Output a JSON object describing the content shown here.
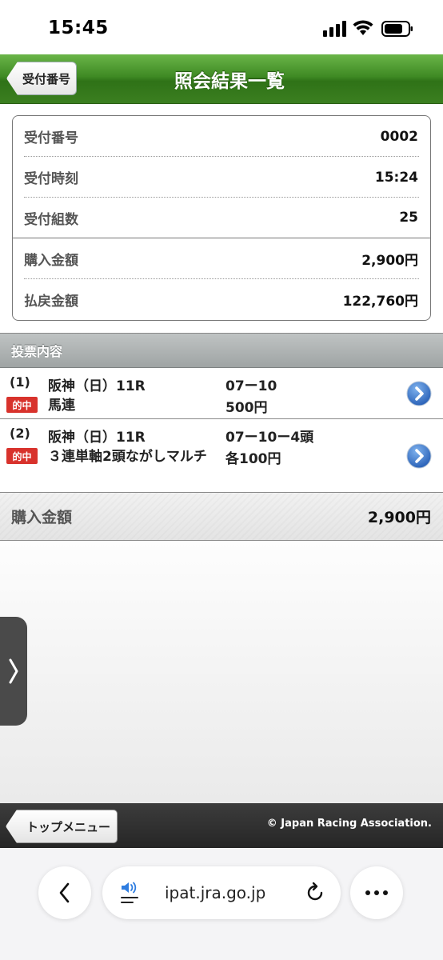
{
  "status_bar": {
    "time": "15:45"
  },
  "header": {
    "back_label": "受付番号",
    "title": "照会結果一覧"
  },
  "summary": {
    "rows": [
      {
        "label": "受付番号",
        "value": "0002"
      },
      {
        "label": "受付時刻",
        "value": "15:24"
      },
      {
        "label": "受付組数",
        "value": "25"
      },
      {
        "label": "購入金額",
        "value": "2,900円"
      },
      {
        "label": "払戻金額",
        "value": "122,760円"
      }
    ]
  },
  "votes": {
    "heading": "投票内容",
    "items": [
      {
        "num": "(1)",
        "badge": "的中",
        "venue": "阪神（日）11R",
        "type": "馬連",
        "combo": "07ー10",
        "amount": "500円"
      },
      {
        "num": "(2)",
        "badge": "的中",
        "venue": "阪神（日）11R",
        "type": "３連単軸2頭ながしマルチ",
        "combo": "07ー10ー4頭",
        "amount": "各100円"
      }
    ]
  },
  "total": {
    "label": "購入金額",
    "value": "2,900円"
  },
  "footer": {
    "top_menu_label": "トップメニュー",
    "copyright": "© Japan Racing Association."
  },
  "browser": {
    "url": "ipat.jra.go.jp"
  },
  "colors": {
    "header_green": "#3f8a24",
    "badge_red": "#d8322c",
    "arrow_blue": "#2f6fc4"
  }
}
